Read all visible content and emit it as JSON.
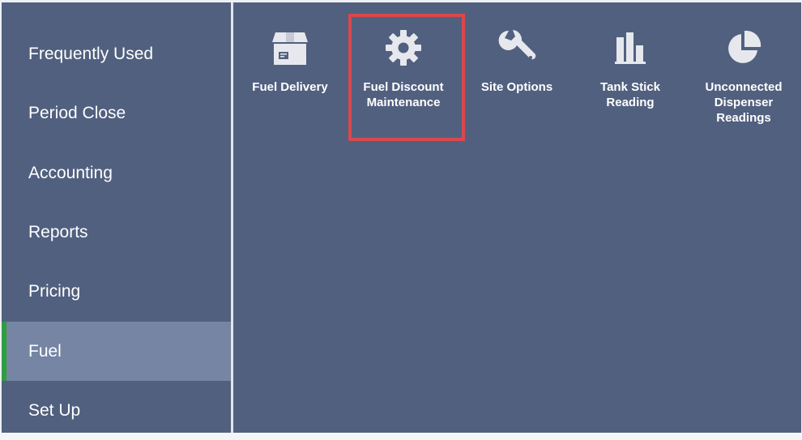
{
  "sidebar": {
    "items": [
      {
        "label": "Frequently Used",
        "active": false
      },
      {
        "label": "Period Close",
        "active": false
      },
      {
        "label": "Accounting",
        "active": false
      },
      {
        "label": "Reports",
        "active": false
      },
      {
        "label": "Pricing",
        "active": false
      },
      {
        "label": "Fuel",
        "active": true
      },
      {
        "label": "Set Up",
        "active": false
      }
    ]
  },
  "tiles": [
    {
      "label": "Fuel Delivery",
      "icon": "box-icon"
    },
    {
      "label": "Fuel Discount\nMaintenance",
      "icon": "gear-icon",
      "highlighted": true
    },
    {
      "label": "Site Options",
      "icon": "wrench-icon"
    },
    {
      "label": "Tank Stick\nReading",
      "icon": "bar-chart-icon"
    },
    {
      "label": "Unconnected\nDispenser\nReadings",
      "icon": "pie-chart-icon"
    }
  ],
  "colors": {
    "background": "#51607f",
    "active_item": "#7585a3",
    "active_marker": "#2e9e3e",
    "highlight_border": "#d9484d",
    "icon": "#e6e8ee",
    "divider": "#e2e5ec"
  }
}
